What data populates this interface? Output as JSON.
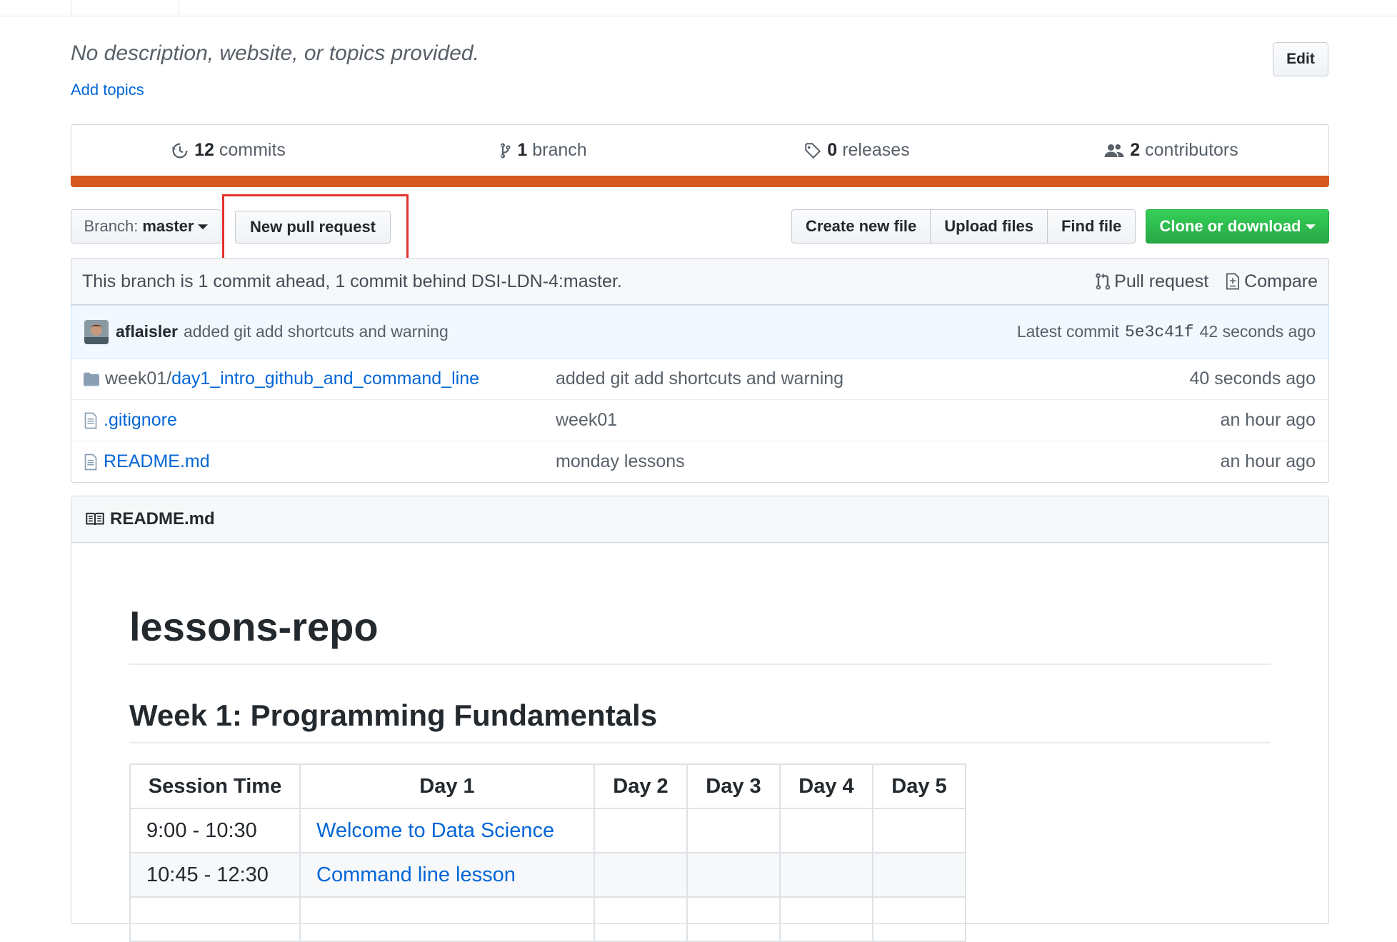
{
  "repo": {
    "description": "No description, website, or topics provided.",
    "add_topics": "Add topics",
    "edit_label": "Edit"
  },
  "summary": {
    "commits": {
      "count": "12",
      "label": "commits",
      "icon": "history-icon"
    },
    "branches": {
      "count": "1",
      "label": "branch",
      "icon": "git-branch-icon"
    },
    "releases": {
      "count": "0",
      "label": "releases",
      "icon": "tag-icon"
    },
    "contributors": {
      "count": "2",
      "label": "contributors",
      "icon": "people-icon"
    },
    "language_color": "#d4581f"
  },
  "toolbar": {
    "branch_prefix": "Branch:",
    "branch_name": "master",
    "new_pull_request": "New pull request",
    "create_new_file": "Create new file",
    "upload_files": "Upload files",
    "find_file": "Find file",
    "clone_or_download": "Clone or download"
  },
  "branch_info": {
    "text": "This branch is 1 commit ahead, 1 commit behind DSI-LDN-4:master.",
    "pull_request": "Pull request",
    "compare": "Compare"
  },
  "latest_commit": {
    "author": "aflaisler",
    "message": "added git add shortcuts and warning",
    "prefix": "Latest commit",
    "sha": "5e3c41f",
    "age": "42 seconds ago"
  },
  "files": [
    {
      "type": "dir",
      "prefix": "week01/",
      "name": "day1_intro_github_and_command_line",
      "message": "added git add shortcuts and warning",
      "age": "40 seconds ago"
    },
    {
      "type": "file",
      "prefix": "",
      "name": ".gitignore",
      "message": "week01",
      "age": "an hour ago"
    },
    {
      "type": "file",
      "prefix": "",
      "name": "README.md",
      "message": "monday lessons",
      "age": "an hour ago"
    }
  ],
  "readme": {
    "filename": "README.md",
    "title": "lessons-repo",
    "heading": "Week 1: Programming Fundamentals",
    "table": {
      "headers": [
        "Session Time",
        "Day 1",
        "Day 2",
        "Day 3",
        "Day 4",
        "Day 5"
      ],
      "rows": [
        [
          "9:00 - 10:30",
          "Welcome to Data Science",
          "",
          "",
          "",
          ""
        ],
        [
          "10:45 - 12:30",
          "Command line lesson",
          "",
          "",
          "",
          ""
        ]
      ]
    }
  },
  "colors": {
    "link": "#0366d6",
    "highlight": "#e2332d",
    "clone_green": "#28a745"
  }
}
